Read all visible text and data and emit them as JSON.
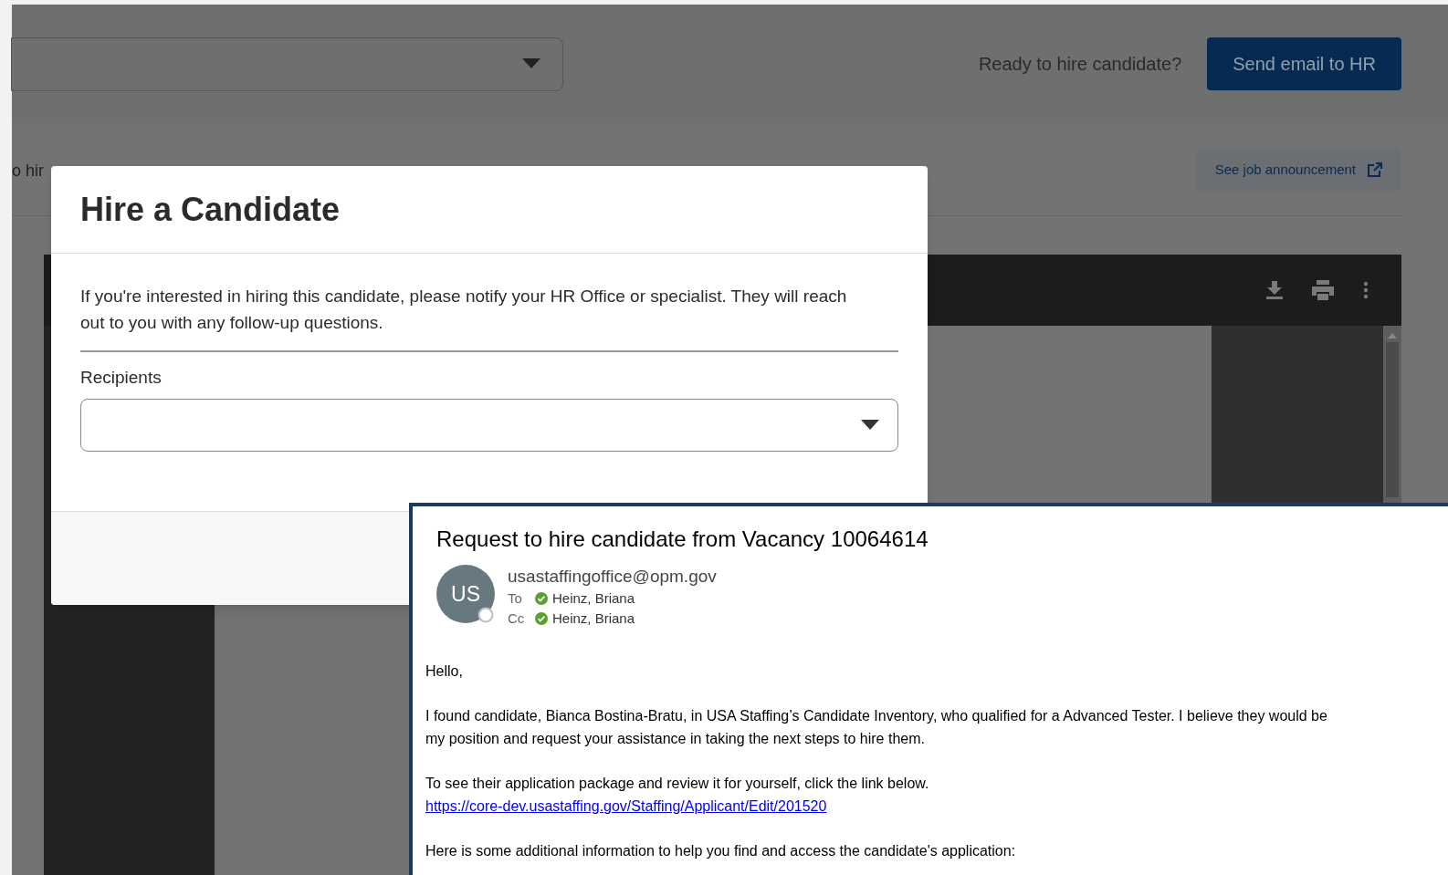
{
  "page": {
    "hire_prompt": "Ready to hire candidate?",
    "send_button": "Send email to HR",
    "info_fragment": "o hir",
    "announcement_link": "See job announcement"
  },
  "modal": {
    "title": "Hire a Candidate",
    "description": "If you're interested in hiring this candidate, please notify your HR Office or specialist. They will reach out to you with any follow-up questions.",
    "recipients_label": "Recipients"
  },
  "email": {
    "subject": "Request to hire candidate from Vacancy 10064614",
    "avatar_initials": "US",
    "sender": "usastaffingoffice@opm.gov",
    "recipients": [
      {
        "label": "To",
        "name": "Heinz, Briana"
      },
      {
        "label": "Cc",
        "name": "Heinz, Briana"
      }
    ],
    "body": [
      {
        "lines": [
          "Hello,"
        ]
      },
      {
        "lines": [
          "I found candidate, Bianca Bostina-Bratu, in USA Staffing’s Candidate Inventory, who qualified for a Advanced Tester. I believe they would be",
          "my position and request your assistance in taking the next steps to hire them."
        ]
      },
      {
        "lines": [
          "To see their application package and review it for yourself, click the link below."
        ],
        "link": "https://core-dev.usastaffing.gov/Staffing/Applicant/Edit/201520"
      },
      {
        "lines": [
          "Here is some additional information to help you find and access the candidate's application:"
        ]
      }
    ]
  }
}
